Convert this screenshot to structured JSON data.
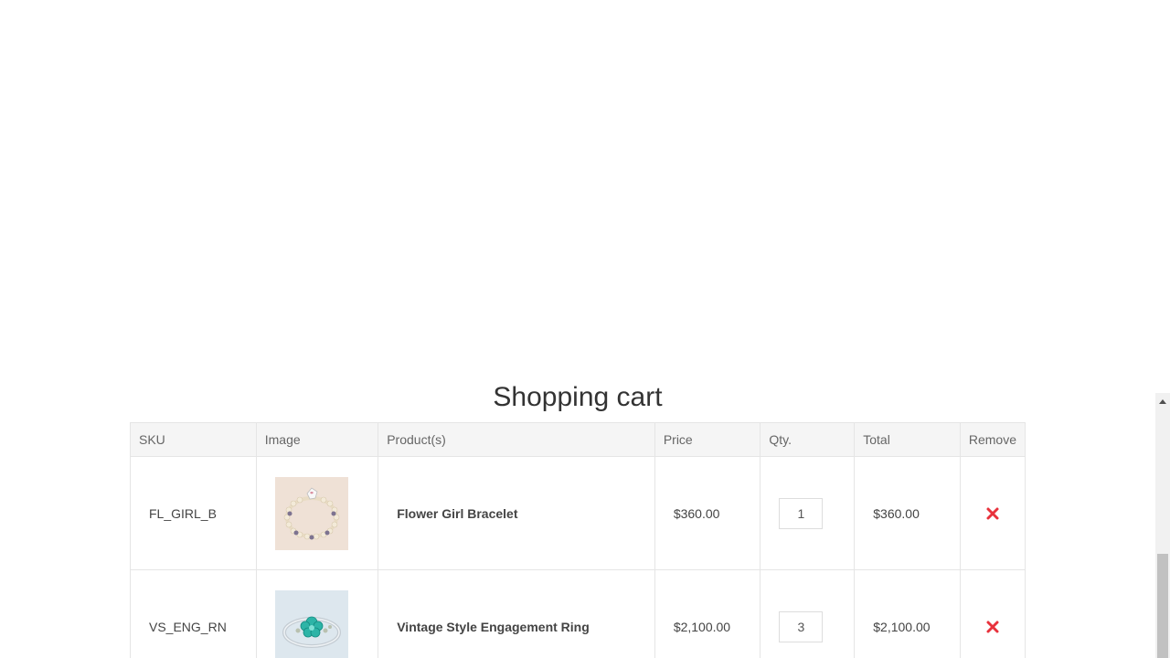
{
  "cart": {
    "title": "Shopping cart",
    "headers": {
      "sku": "SKU",
      "image": "Image",
      "product": "Product(s)",
      "price": "Price",
      "qty": "Qty.",
      "total": "Total",
      "remove": "Remove"
    },
    "items": [
      {
        "sku": "FL_GIRL_B",
        "name": "Flower Girl Bracelet",
        "price": "$360.00",
        "qty": "1",
        "total": "$360.00",
        "image_icon": "bracelet-product-image"
      },
      {
        "sku": "VS_ENG_RN",
        "name": "Vintage Style Engagement Ring",
        "price": "$2,100.00",
        "qty": "3",
        "total": "$2,100.00",
        "image_icon": "ring-product-image"
      }
    ]
  },
  "colors": {
    "remove_icon": "#e8323c",
    "header_bg": "#f5f5f5",
    "border": "#e5e5e5"
  },
  "scrollbar_position": 1.0
}
